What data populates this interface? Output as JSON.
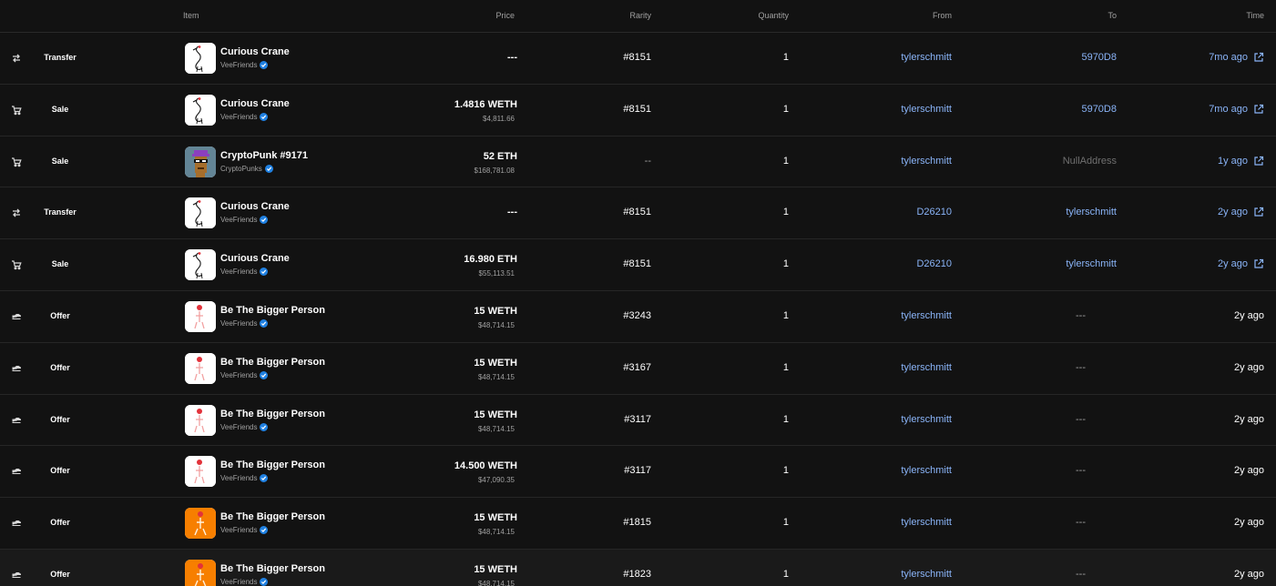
{
  "header": {
    "item": "Item",
    "price": "Price",
    "rarity": "Rarity",
    "quantity": "Quantity",
    "from": "From",
    "to": "To",
    "time": "Time"
  },
  "colors": {
    "link": "#8ab4f8",
    "verified": "#2081e2",
    "background": "#121212"
  },
  "rows": [
    {
      "event": "Transfer",
      "event_icon": "transfer-icon",
      "item": "Curious Crane",
      "collection": "VeeFriends",
      "thumb": "crane",
      "price": "---",
      "usd": "",
      "rarity": "#8151",
      "quantity": "1",
      "from": "tylerschmitt",
      "to": "5970D8",
      "time": "7mo ago",
      "time_link": true
    },
    {
      "event": "Sale",
      "event_icon": "cart-icon",
      "item": "Curious Crane",
      "collection": "VeeFriends",
      "thumb": "crane",
      "price": "1.4816 WETH",
      "usd": "$4,811.66",
      "rarity": "#8151",
      "quantity": "1",
      "from": "tylerschmitt",
      "to": "5970D8",
      "time": "7mo ago",
      "time_link": true
    },
    {
      "event": "Sale",
      "event_icon": "cart-icon",
      "item": "CryptoPunk #9171",
      "collection": "CryptoPunks",
      "thumb": "punk",
      "price": "52 ETH",
      "usd": "$168,781.08",
      "rarity": "--",
      "quantity": "1",
      "from": "tylerschmitt",
      "to": "NullAddress",
      "time": "1y ago",
      "time_link": true
    },
    {
      "event": "Transfer",
      "event_icon": "transfer-icon",
      "item": "Curious Crane",
      "collection": "VeeFriends",
      "thumb": "crane",
      "price": "---",
      "usd": "",
      "rarity": "#8151",
      "quantity": "1",
      "from": "D26210",
      "to": "tylerschmitt",
      "time": "2y ago",
      "time_link": true
    },
    {
      "event": "Sale",
      "event_icon": "cart-icon",
      "item": "Curious Crane",
      "collection": "VeeFriends",
      "thumb": "crane",
      "price": "16.980 ETH",
      "usd": "$55,113.51",
      "rarity": "#8151",
      "quantity": "1",
      "from": "D26210",
      "to": "tylerschmitt",
      "time": "2y ago",
      "time_link": true
    },
    {
      "event": "Offer",
      "event_icon": "offer-icon",
      "item": "Be The Bigger Person",
      "collection": "VeeFriends",
      "thumb": "bigger-white",
      "price": "15 WETH",
      "usd": "$48,714.15",
      "rarity": "#3243",
      "quantity": "1",
      "from": "tylerschmitt",
      "to": "---",
      "time": "2y ago",
      "time_link": false
    },
    {
      "event": "Offer",
      "event_icon": "offer-icon",
      "item": "Be The Bigger Person",
      "collection": "VeeFriends",
      "thumb": "bigger-white",
      "price": "15 WETH",
      "usd": "$48,714.15",
      "rarity": "#3167",
      "quantity": "1",
      "from": "tylerschmitt",
      "to": "---",
      "time": "2y ago",
      "time_link": false
    },
    {
      "event": "Offer",
      "event_icon": "offer-icon",
      "item": "Be The Bigger Person",
      "collection": "VeeFriends",
      "thumb": "bigger-white",
      "price": "15 WETH",
      "usd": "$48,714.15",
      "rarity": "#3117",
      "quantity": "1",
      "from": "tylerschmitt",
      "to": "---",
      "time": "2y ago",
      "time_link": false
    },
    {
      "event": "Offer",
      "event_icon": "offer-icon",
      "item": "Be The Bigger Person",
      "collection": "VeeFriends",
      "thumb": "bigger-white",
      "price": "14.500 WETH",
      "usd": "$47,090.35",
      "rarity": "#3117",
      "quantity": "1",
      "from": "tylerschmitt",
      "to": "---",
      "time": "2y ago",
      "time_link": false
    },
    {
      "event": "Offer",
      "event_icon": "offer-icon",
      "item": "Be The Bigger Person",
      "collection": "VeeFriends",
      "thumb": "bigger-orange",
      "price": "15 WETH",
      "usd": "$48,714.15",
      "rarity": "#1815",
      "quantity": "1",
      "from": "tylerschmitt",
      "to": "---",
      "time": "2y ago",
      "time_link": false
    },
    {
      "event": "Offer",
      "event_icon": "offer-icon",
      "item": "Be The Bigger Person",
      "collection": "VeeFriends",
      "thumb": "bigger-orange",
      "price": "15 WETH",
      "usd": "$48,714.15",
      "rarity": "#1823",
      "quantity": "1",
      "from": "tylerschmitt",
      "to": "---",
      "time": "2y ago",
      "time_link": false
    }
  ]
}
